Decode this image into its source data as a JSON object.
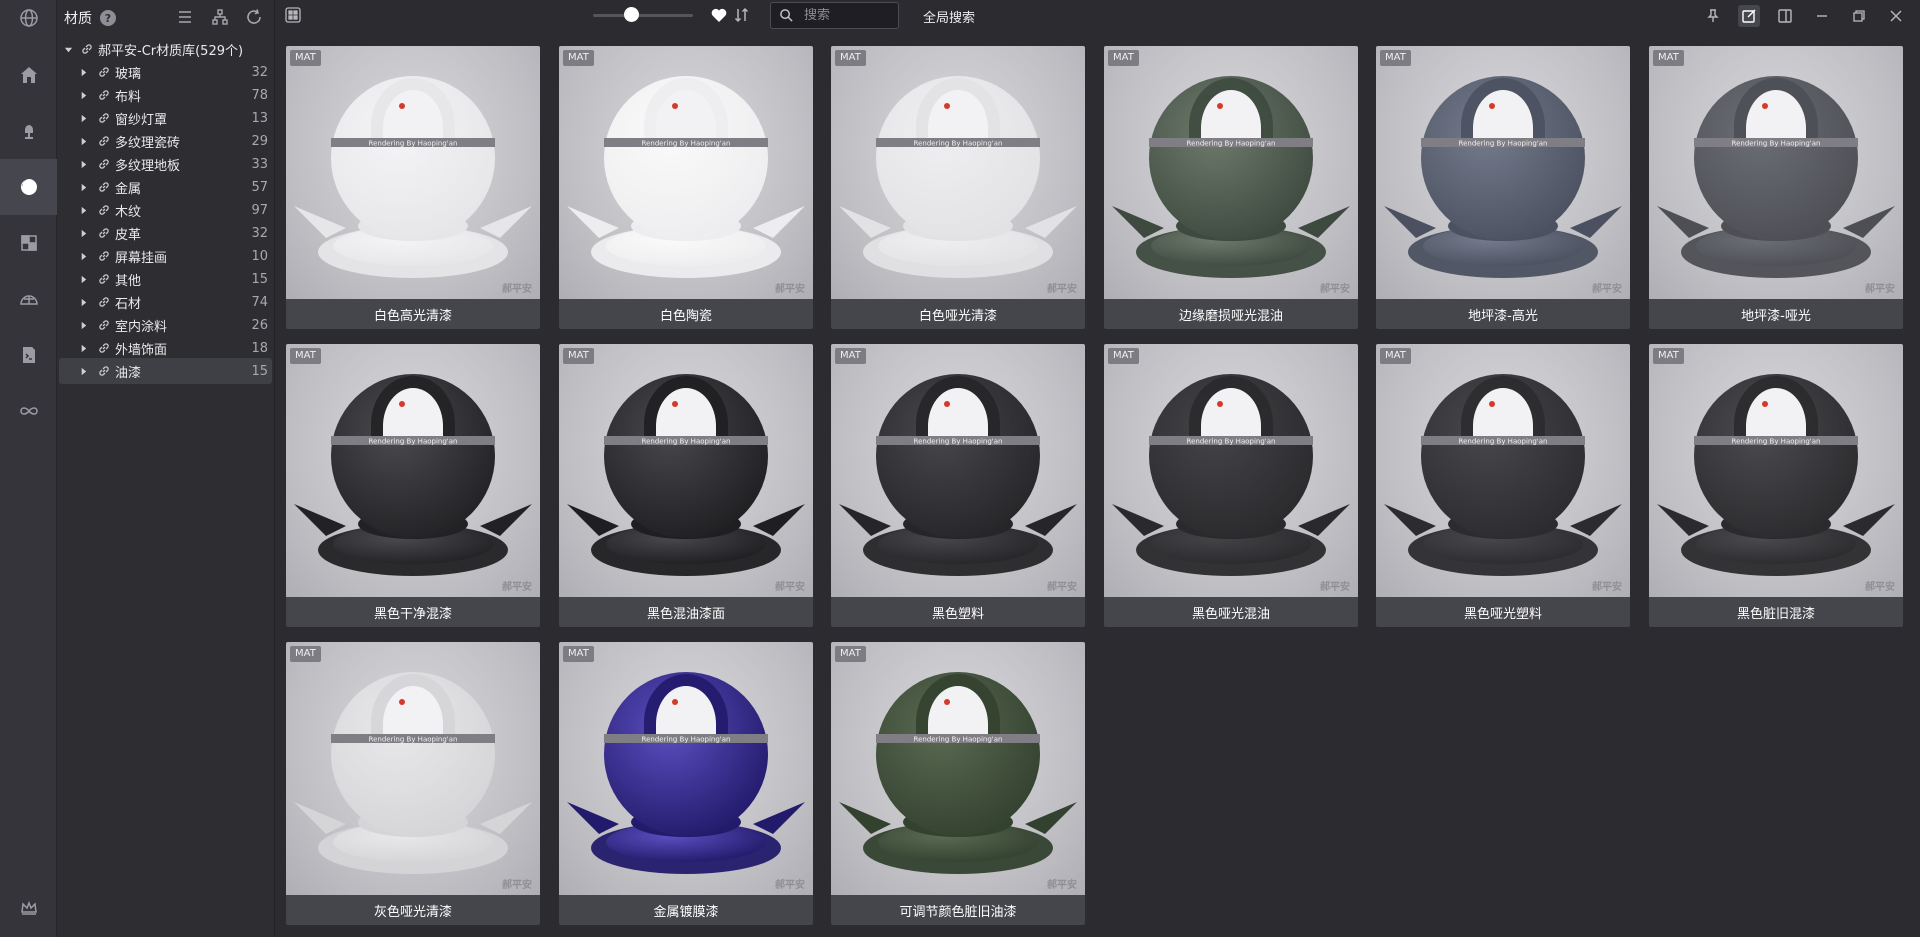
{
  "rail": {
    "items": [
      {
        "icon": "globe-icon"
      },
      {
        "icon": "home-icon"
      },
      {
        "icon": "lamp-icon"
      },
      {
        "icon": "material-sphere-icon",
        "active": true
      },
      {
        "icon": "texture-icon"
      },
      {
        "icon": "sky-dome-icon"
      },
      {
        "icon": "script-icon"
      },
      {
        "icon": "infinity-icon"
      }
    ],
    "bottom_icon": "crown-icon"
  },
  "panel": {
    "title": "材质",
    "help": "?",
    "root": {
      "label": "郝平安-Cr材质库(529个)"
    },
    "items": [
      {
        "label": "玻璃",
        "count": "32"
      },
      {
        "label": "布料",
        "count": "78"
      },
      {
        "label": "窗纱灯罩",
        "count": "13"
      },
      {
        "label": "多纹理瓷砖",
        "count": "29"
      },
      {
        "label": "多纹理地板",
        "count": "33"
      },
      {
        "label": "金属",
        "count": "57"
      },
      {
        "label": "木纹",
        "count": "97"
      },
      {
        "label": "皮革",
        "count": "32"
      },
      {
        "label": "屏幕挂画",
        "count": "10"
      },
      {
        "label": "其他",
        "count": "15"
      },
      {
        "label": "石材",
        "count": "74"
      },
      {
        "label": "室内涂料",
        "count": "26"
      },
      {
        "label": "外墙饰面",
        "count": "18"
      },
      {
        "label": "油漆",
        "count": "15",
        "selected": true
      }
    ]
  },
  "topbar": {
    "search_placeholder": "搜索",
    "global_search": "全局搜索",
    "zoom_fraction": 0.38
  },
  "grid": {
    "badge": "MAT",
    "sphere_text": "Rendering By Haoping'an",
    "items": [
      {
        "label": "白色高光清漆",
        "color": "#e6e6e8",
        "accent": "#f4f4f6"
      },
      {
        "label": "白色陶瓷",
        "color": "#ededef",
        "accent": "#fafafa"
      },
      {
        "label": "白色哑光清漆",
        "color": "#e2e2e4",
        "accent": "#efeff1"
      },
      {
        "label": "边缘磨损哑光混油",
        "color": "#3e4a3f",
        "accent": "#6d7a6b"
      },
      {
        "label": "地坪漆-高光",
        "color": "#4b5160",
        "accent": "#747b8c"
      },
      {
        "label": "地坪漆-哑光",
        "color": "#4d4f55",
        "accent": "#6c6e75"
      },
      {
        "label": "黑色干净混漆",
        "color": "#222225",
        "accent": "#4a4a4f"
      },
      {
        "label": "黑色混油漆面",
        "color": "#1f1f22",
        "accent": "#48484d"
      },
      {
        "label": "黑色塑料",
        "color": "#262629",
        "accent": "#47474c"
      },
      {
        "label": "黑色哑光混油",
        "color": "#2a2a2d",
        "accent": "#444448"
      },
      {
        "label": "黑色哑光塑料",
        "color": "#2c2c30",
        "accent": "#48484c"
      },
      {
        "label": "黑色脏旧混漆",
        "color": "#2b2b2e",
        "accent": "#4b4b4f"
      },
      {
        "label": "灰色哑光清漆",
        "color": "#d5d5d8",
        "accent": "#e8e8ea"
      },
      {
        "label": "金属镀膜漆",
        "color": "#221a6a",
        "accent": "#5b4ec0"
      },
      {
        "label": "可调节颜色脏旧油漆",
        "color": "#33412f",
        "accent": "#5a6a52"
      }
    ]
  }
}
